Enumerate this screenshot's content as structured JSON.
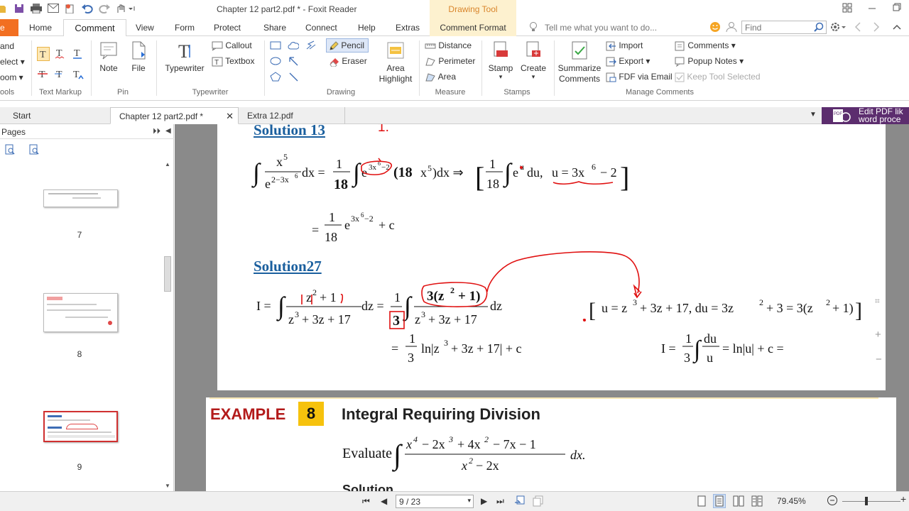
{
  "window": {
    "title": "Chapter 12 part2.pdf * - Foxit Reader",
    "contextual_tab": "Drawing Tool"
  },
  "ribbon_tabs": {
    "file": "e",
    "home": "Home",
    "comment": "Comment",
    "view": "View",
    "form": "Form",
    "protect": "Protect",
    "share": "Share",
    "connect": "Connect",
    "help": "Help",
    "extras": "Extras",
    "comment_format": "Comment Format"
  },
  "tell_me": "Tell me what you want to do...",
  "search": {
    "placeholder": "Find"
  },
  "ribbon": {
    "tools": {
      "hand": "and",
      "select": "elect",
      "zoom": "oom",
      "label": "ools"
    },
    "text_markup": {
      "label": "Text Markup"
    },
    "pin": {
      "note": "Note",
      "file": "File",
      "label": "Pin"
    },
    "typewriter": {
      "typewriter": "Typewriter",
      "callout": "Callout",
      "textbox": "Textbox",
      "label": "Typewriter"
    },
    "drawing": {
      "pencil": "Pencil",
      "eraser": "Eraser",
      "area_highlight_1": "Area",
      "area_highlight_2": "Highlight",
      "label": "Drawing"
    },
    "measure": {
      "distance": "Distance",
      "perimeter": "Perimeter",
      "area": "Area",
      "label": "Measure"
    },
    "stamps": {
      "stamp": "Stamp",
      "create": "Create",
      "label": "Stamps"
    },
    "manage": {
      "summarize_1": "Summarize",
      "summarize_2": "Comments",
      "import": "Import",
      "export": "Export",
      "fdf_email": "FDF via Email",
      "comments": "Comments",
      "popup_notes": "Popup Notes",
      "keep_tool": "Keep Tool Selected",
      "label": "Manage Comments"
    }
  },
  "doc_tabs": {
    "start": "Start",
    "active": "Chapter 12 part2.pdf *",
    "extra": "Extra 12.pdf",
    "promo_1": "Edit PDF lik",
    "promo_2": "word proce"
  },
  "pages_panel": {
    "title": "Pages",
    "thumbs": [
      "7",
      "8",
      "9"
    ]
  },
  "document": {
    "solution13": "Solution 13",
    "s13_annotation": "1.",
    "solution27": "Solution27",
    "example_label": "EXAMPLE",
    "example_num": "8",
    "example_title": "Integral Requiring Division",
    "evaluate": "Evaluate",
    "solution_cut": "Solution"
  },
  "status": {
    "page_indicator": "9 / 23",
    "zoom": "79.45%"
  },
  "colors": {
    "file_tab": "#f26f21",
    "drawing_tool_bg": "#fdf1cf",
    "solution_heading": "#1a5f9e",
    "annotation": "#e01010",
    "example_red": "#b31b1b",
    "example_badge": "#f6c20d"
  }
}
